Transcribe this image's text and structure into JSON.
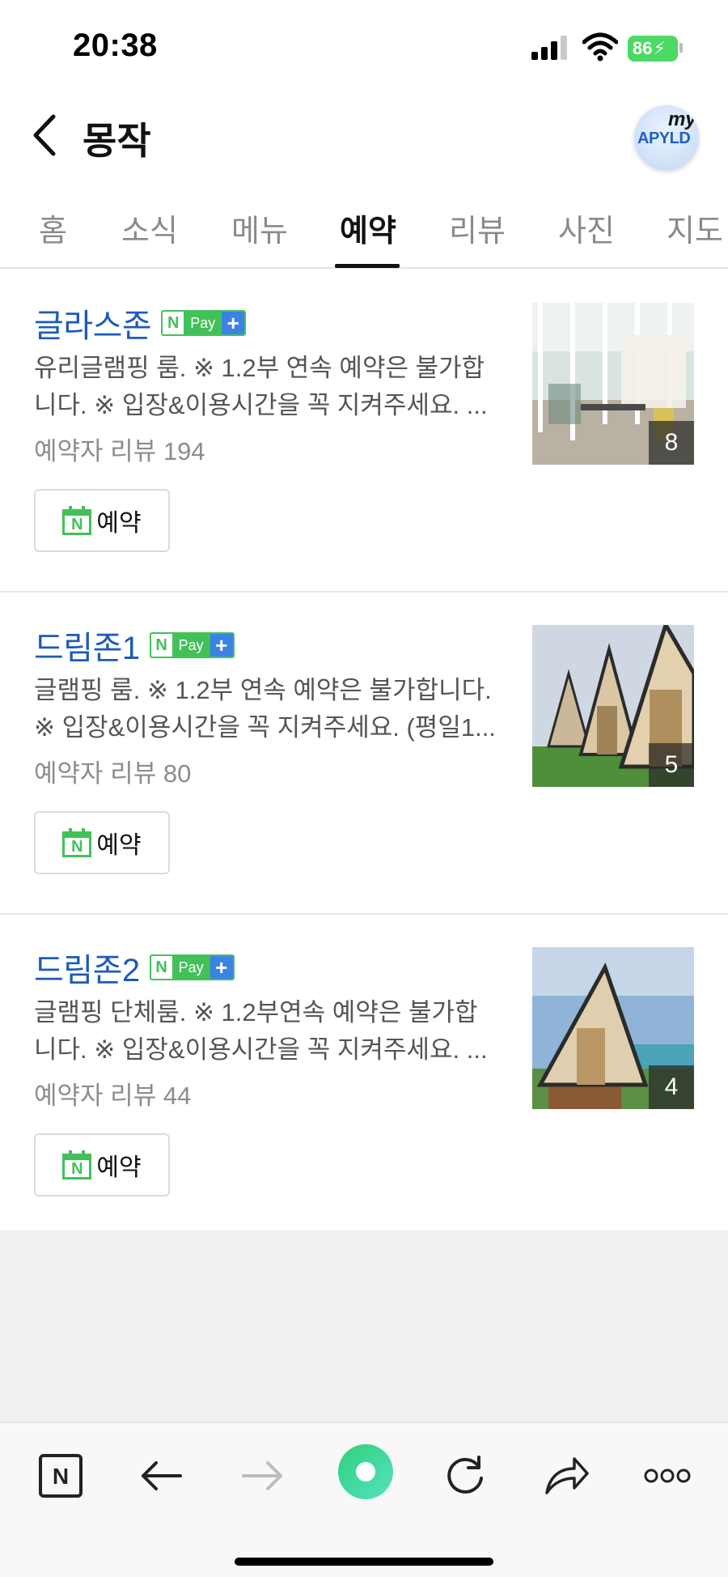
{
  "status_bar": {
    "time": "20:38",
    "battery": "86"
  },
  "header": {
    "title": "몽작",
    "avatar_my": "my",
    "avatar_brand": "APYLD"
  },
  "tabs": [
    {
      "label": "홈"
    },
    {
      "label": "소식"
    },
    {
      "label": "메뉴"
    },
    {
      "label": "예약",
      "active": true
    },
    {
      "label": "리뷰"
    },
    {
      "label": "사진"
    },
    {
      "label": "지도"
    }
  ],
  "items": [
    {
      "title": "글라스존",
      "desc_line1": "유리글램핑 룸. ※ 1.2부 연속 예약은 불가합",
      "desc_line2": "니다. ※ 입장&이용시간을 꼭 지켜주세요. ...",
      "reviews": "예약자 리뷰 194",
      "reserve_label": "예약",
      "photo_count": "8"
    },
    {
      "title": "드림존1",
      "desc_line1": "글램핑 룸. ※ 1.2부 연속 예약은 불가합니다.",
      "desc_line2": "※ 입장&이용시간을 꼭 지켜주세요. (평일1...",
      "reviews": "예약자 리뷰 80",
      "reserve_label": "예약",
      "photo_count": "5"
    },
    {
      "title": "드림존2",
      "desc_line1": "글램핑 단체룸. ※ 1.2부연속 예약은 불가합",
      "desc_line2": "니다. ※ 입장&이용시간을 꼭 지켜주세요. ...",
      "reviews": "예약자 리뷰 44",
      "reserve_label": "예약",
      "photo_count": "4"
    }
  ],
  "npay": {
    "n": "N",
    "pay": "Pay",
    "plus": "+"
  },
  "toolbar": {
    "icons": [
      "naver-home-icon",
      "back-arrow-icon",
      "forward-arrow-icon",
      "green-dot-icon",
      "refresh-icon",
      "share-icon",
      "more-icon"
    ],
    "n_label": "N"
  },
  "colors": {
    "title_blue": "#1e5bb8",
    "naver_green": "#42c158",
    "pay_blue": "#3b82e6"
  }
}
